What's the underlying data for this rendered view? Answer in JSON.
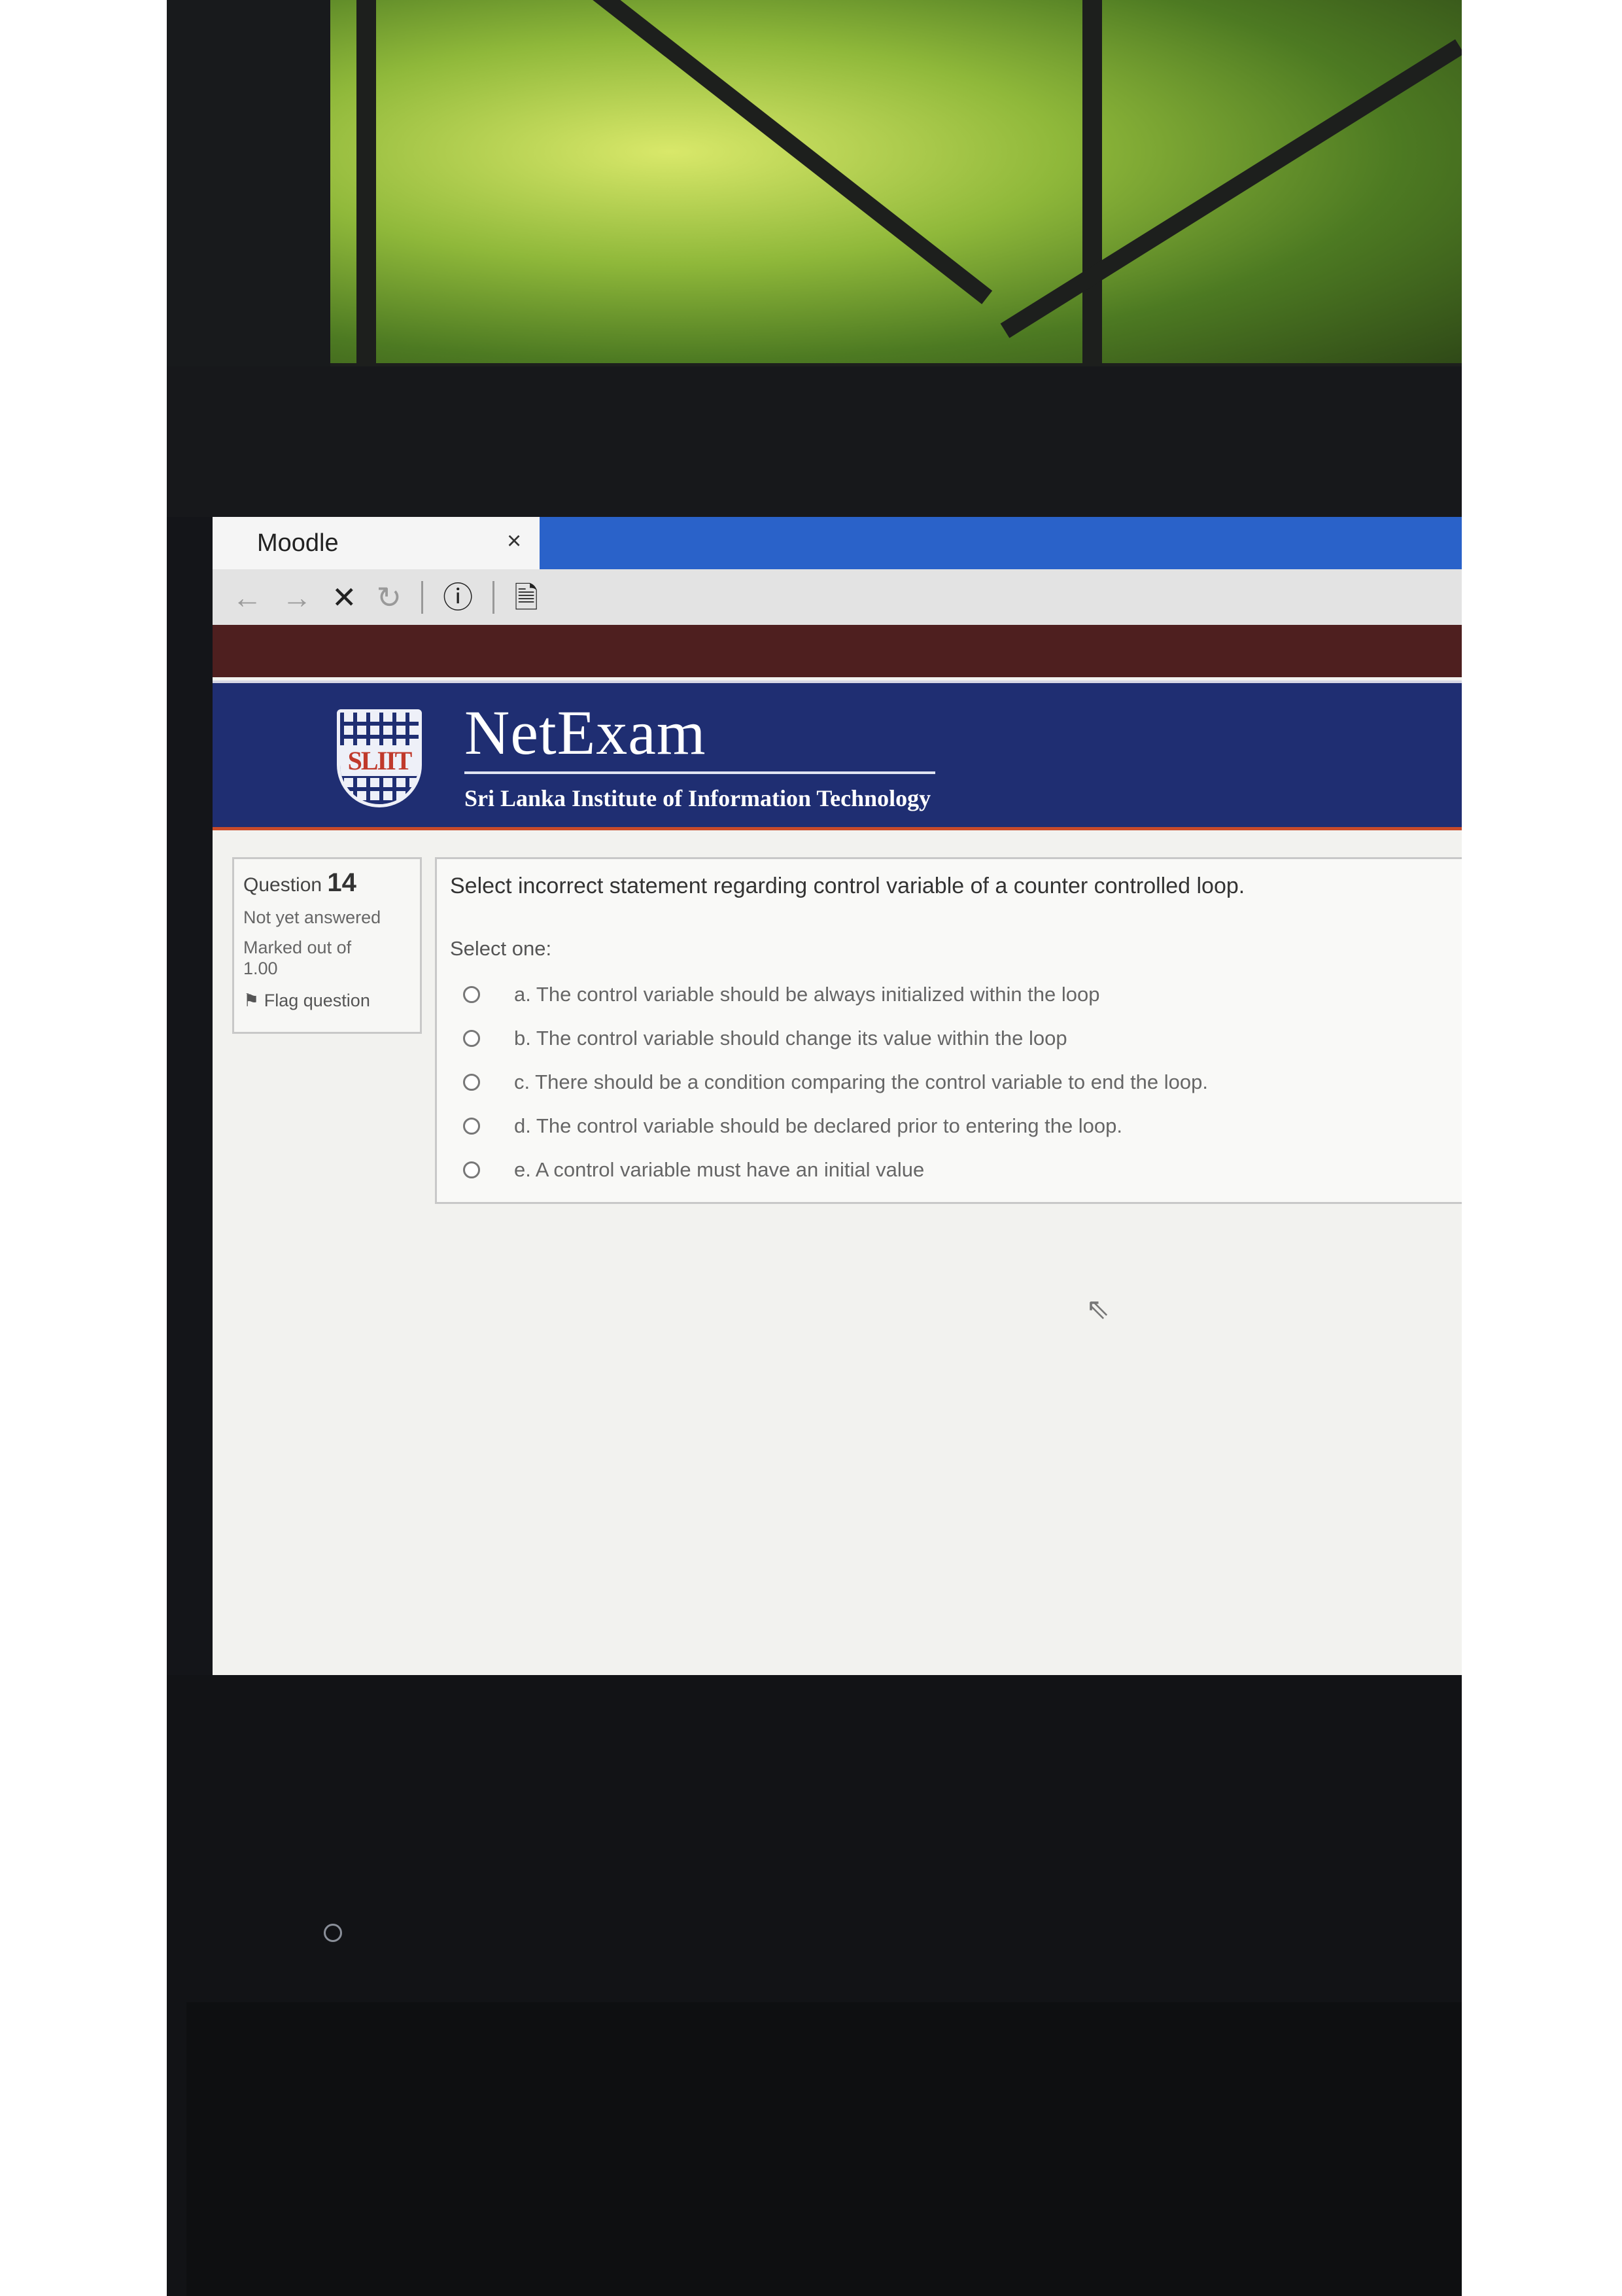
{
  "browser": {
    "tab_title": "Moodle",
    "tab_close": "×",
    "nav_icons": [
      "back-arrow-icon",
      "forward-arrow-icon",
      "stop-icon",
      "reload-icon",
      "info-icon",
      "page-icon"
    ]
  },
  "banner": {
    "title": "NetExam",
    "subtitle": "Sri Lanka Institute of Information Technology",
    "logo_text": "SLIIT"
  },
  "question_info": {
    "label": "Question",
    "number": "14",
    "status": "Not yet answered",
    "marked_label": "Marked out of",
    "marked_value": "1.00",
    "flag_label": "Flag question"
  },
  "question": {
    "text": "Select incorrect statement regarding control variable of a counter controlled loop.",
    "prompt": "Select one:",
    "options": [
      "a. The control variable should be always initialized within the loop",
      "b. The control variable should change its value within the loop",
      "c. There should be a condition comparing the control variable to end the loop.",
      "d. The control variable should be declared prior to entering the loop.",
      "e. A control variable must have an initial value"
    ]
  },
  "colors": {
    "banner": "#1f2e72",
    "tabstrip": "#2a62c9",
    "maroon_bar": "#4e1f1f",
    "accent_line": "#c94b2a"
  }
}
